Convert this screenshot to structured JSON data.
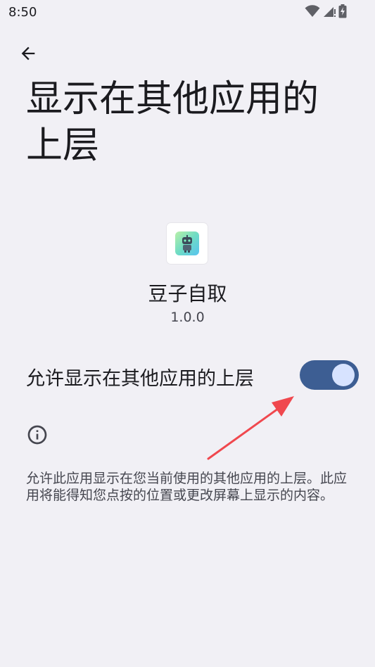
{
  "status_bar": {
    "time": "8:50",
    "icons": [
      "wifi-icon",
      "cellular-signal-icon",
      "battery-charging-icon"
    ]
  },
  "header": {
    "back_icon": "arrow-left-icon",
    "title": "显示在其他应用的上层"
  },
  "app": {
    "name": "豆子自取",
    "version": "1.0.0",
    "icon": "app-robot-icon"
  },
  "setting": {
    "label": "允许显示在其他应用的上层",
    "enabled": true
  },
  "info": {
    "icon": "info-icon",
    "description": "允许此应用显示在您当前使用的其他应用的上层。此应用将能得知您点按的位置或更改屏幕上显示的内容。"
  },
  "colors": {
    "background": "#f1f0f5",
    "switch_track": "#3d5e93",
    "switch_knob": "#d7e3ff",
    "annotation_arrow": "#f0484e"
  }
}
